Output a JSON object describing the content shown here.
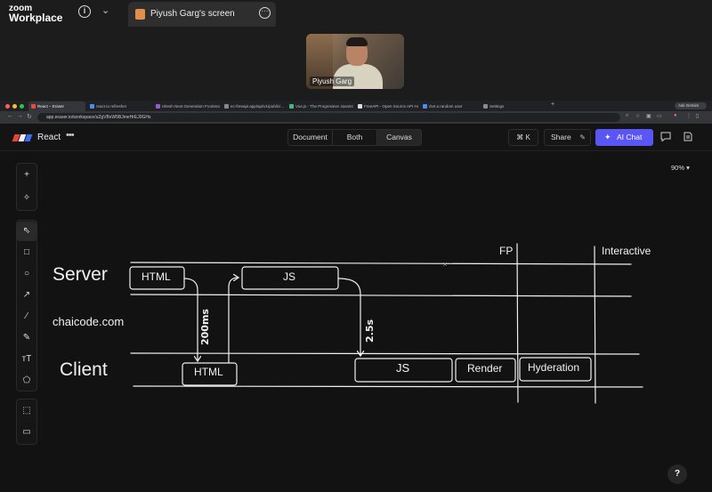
{
  "zoom": {
    "logo_line1": "zoom",
    "logo_line2": "Workplace",
    "info_glyph": "i",
    "chevron_glyph": "⌄",
    "share_tab_title": "Piyush Garg's screen",
    "more_glyph": "···",
    "participant_name": "Piyush Garg"
  },
  "browser": {
    "tabs": [
      {
        "label": "React – Eraser",
        "active": true,
        "favicon_color": "#e84a3c"
      },
      {
        "label": "react to refresher",
        "active": false,
        "favicon_color": "#4a8cf0"
      },
      {
        "label": "Hitesh Next Generation Frontend...",
        "active": false,
        "favicon_color": "#9b59d0"
      },
      {
        "label": "ec-freeapi.app/api/v1/public/...",
        "active": false,
        "favicon_color": "#888888"
      },
      {
        "label": "Vue.js - The Progressive JavaScript...",
        "active": false,
        "favicon_color": "#42b883"
      },
      {
        "label": "FreeAPI - Open Source API Hub",
        "active": false,
        "favicon_color": "#dddddd"
      },
      {
        "label": "Get a random user",
        "active": false,
        "favicon_color": "#4a8cf0"
      },
      {
        "label": "Settings",
        "active": false,
        "favicon_color": "#8a8a8a"
      }
    ],
    "new_tab_glyph": "+",
    "ask_gemini": "Ask Gemini",
    "url": "app.eraser.io/workspace/uZgVBxW5BJmeHrEJ0GHs"
  },
  "app": {
    "title": "React",
    "more_glyph": "•••",
    "view_modes": [
      "Document",
      "Both",
      "Canvas"
    ],
    "active_view": "Canvas",
    "shortcut_label": "⌘ K",
    "share_label": "Share",
    "ai_chat_label": "AI Chat",
    "zoom_level": "90%",
    "help_label": "?"
  },
  "tools": {
    "top": [
      {
        "name": "add",
        "glyph": "+"
      },
      {
        "name": "ai-sparkle",
        "glyph": "✧"
      }
    ],
    "main": [
      {
        "name": "select",
        "glyph": "⇖"
      },
      {
        "name": "rectangle",
        "glyph": "□"
      },
      {
        "name": "ellipse",
        "glyph": "○"
      },
      {
        "name": "arrow",
        "glyph": "↗"
      },
      {
        "name": "line",
        "glyph": "∕"
      },
      {
        "name": "pen",
        "glyph": "✎"
      },
      {
        "name": "text",
        "glyph": "ᴛT"
      },
      {
        "name": "shapes",
        "glyph": "⬠"
      }
    ],
    "bottom": [
      {
        "name": "frame",
        "glyph": "⬚"
      },
      {
        "name": "comment",
        "glyph": "▭"
      }
    ]
  },
  "diagram": {
    "fp_label": "FP",
    "interactive_label": "Interactive",
    "server_label": "Server",
    "client_label": "Client",
    "site_label": "chaicode.com",
    "server_html": "HTML",
    "server_js": "JS",
    "client_html": "HTML",
    "client_js": "JS",
    "render": "Render",
    "hydration": "Hyderation",
    "delay_1": "200ms",
    "delay_2": "2.5s"
  }
}
